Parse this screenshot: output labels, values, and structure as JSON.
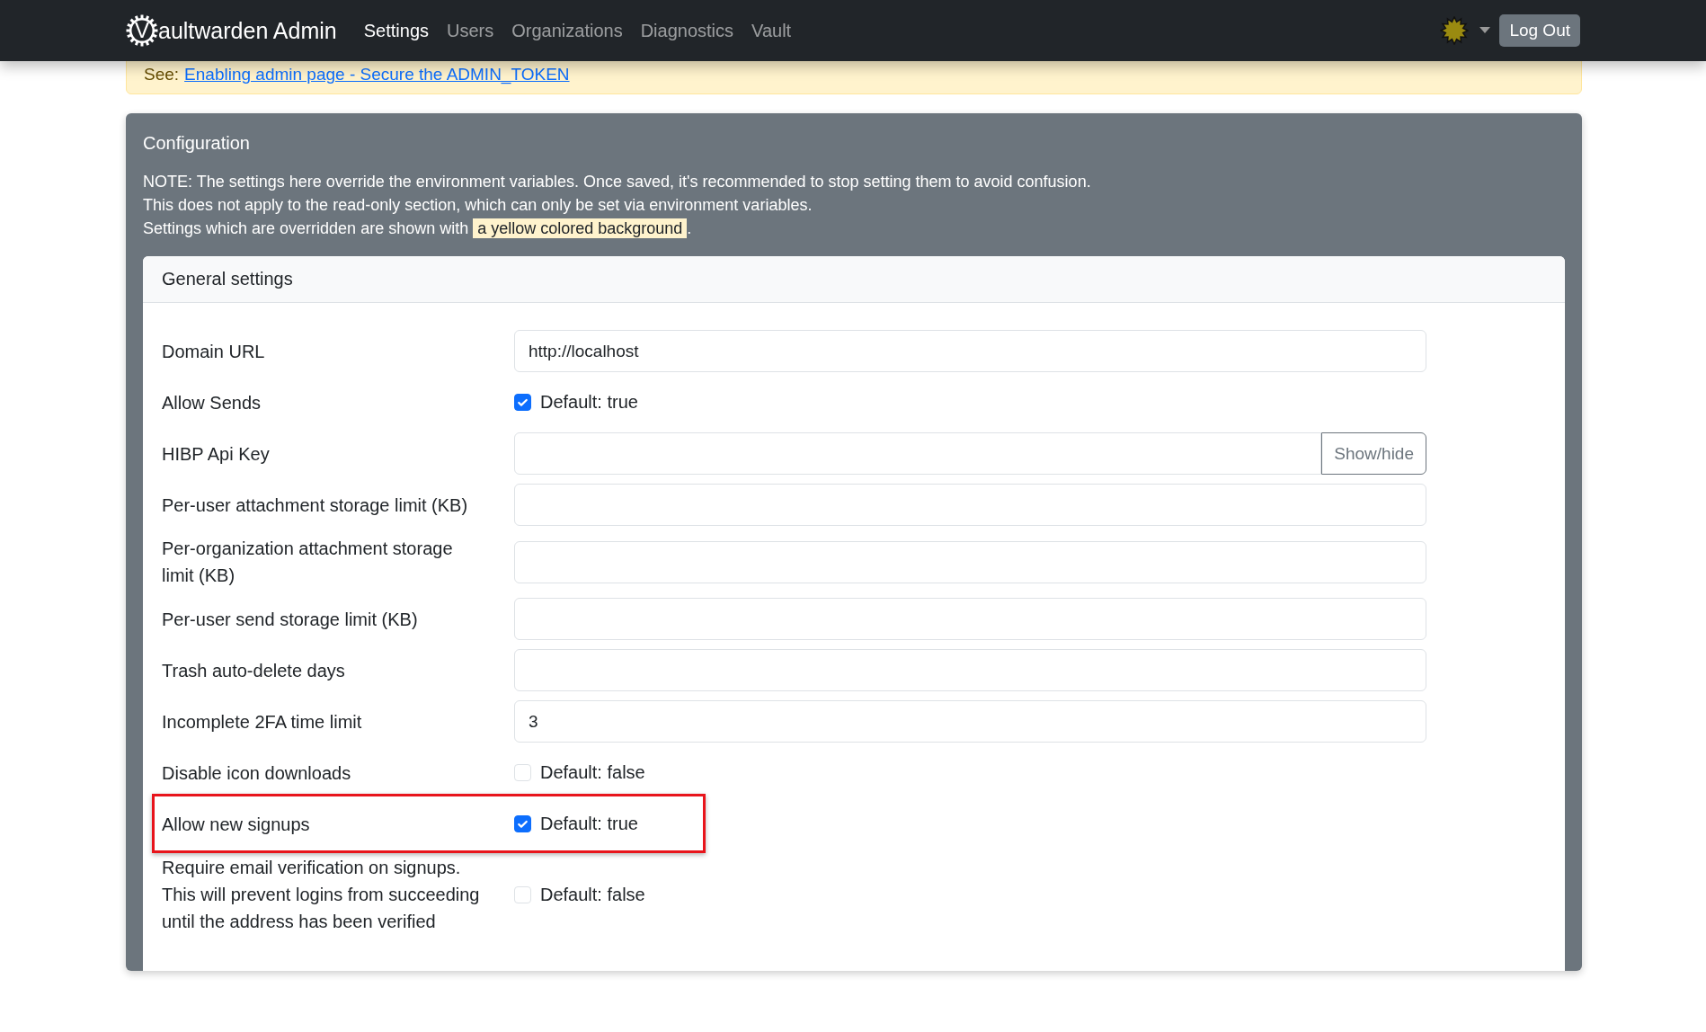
{
  "navbar": {
    "logo_letter": "V",
    "brand": "aultwarden Admin",
    "items": [
      {
        "label": "Settings",
        "selected": true
      },
      {
        "label": "Users",
        "selected": false
      },
      {
        "label": "Organizations",
        "selected": false
      },
      {
        "label": "Diagnostics",
        "selected": false
      },
      {
        "label": "Vault",
        "selected": false
      }
    ],
    "logout": "Log Out"
  },
  "notice": {
    "prefix": "See:",
    "link": "Enabling admin page - Secure the ADMIN_TOKEN"
  },
  "configuration": {
    "title": "Configuration",
    "note_lines": [
      "NOTE: The settings here override the environment variables. Once saved, it's recommended to stop setting them to avoid confusion.",
      "This does not apply to the read-only section, which can only be set via environment variables."
    ],
    "override_prefix": "Settings which are overridden are shown with",
    "override_sample": "a yellow colored background",
    "override_suffix": ".",
    "section": {
      "title": "General settings",
      "rows": [
        {
          "kind": "text",
          "label": "Domain URL",
          "value": "http://localhost",
          "highlighted": false
        },
        {
          "kind": "checkbox",
          "label": "Allow Sends",
          "checked": true,
          "caption": "Default: true",
          "highlighted": false
        },
        {
          "kind": "secret",
          "label": "HIBP Api Key",
          "button": "Show/hide",
          "highlighted": false
        },
        {
          "kind": "text",
          "label": "Per-user attachment storage limit (KB)",
          "highlighted": false
        },
        {
          "kind": "text",
          "label": "Per-organization attachment storage limit (KB)",
          "highlighted": false
        },
        {
          "kind": "text",
          "label": "Per-user send storage limit (KB)",
          "highlighted": false
        },
        {
          "kind": "text",
          "label": "Trash auto-delete days",
          "highlighted": false
        },
        {
          "kind": "text",
          "label": "Incomplete 2FA time limit",
          "value": "3",
          "highlighted": false
        },
        {
          "kind": "checkbox",
          "label": "Disable icon downloads",
          "checked": false,
          "caption": "Default: false",
          "highlighted": false
        },
        {
          "kind": "checkbox",
          "label": "Allow new signups",
          "checked": true,
          "caption": "Default: true",
          "highlighted": true
        },
        {
          "kind": "checkbox",
          "label": "Require email verification on signups. This will prevent logins from succeeding until the address has been verified",
          "checked": false,
          "caption": "Default: false",
          "highlighted": false
        }
      ]
    }
  }
}
